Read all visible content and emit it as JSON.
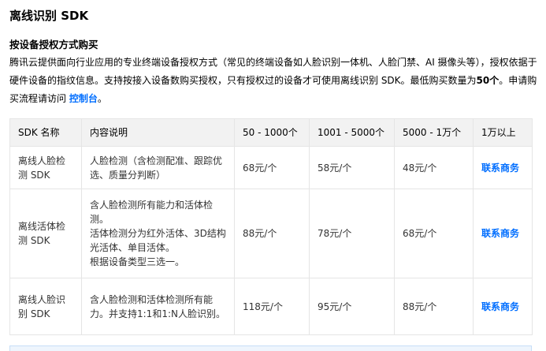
{
  "section_title": "离线识别 SDK",
  "sub_title": "按设备授权方式购买",
  "intro": {
    "text_before": "腾讯云提供面向行业应用的专业终端设备授权方式（常见的终端设备如人脸识别一体机、人脸门禁、AI 摄像头等），授权依据于硬件设备的指纹信息。支持按接入设备数购买授权，只有授权过的设备才可使用离线识别 SDK。最低购买数量为",
    "min_count": "50个",
    "text_middle": "。申请购买流程请访问 ",
    "link": "控制台",
    "text_after": "。"
  },
  "table": {
    "headers": [
      "SDK 名称",
      "内容说明",
      "50 - 1000个",
      "1001 - 5000个",
      "5000 - 1万个",
      "1万以上"
    ],
    "rows": [
      {
        "name": "离线人脸检测 SDK",
        "desc": [
          "人脸检测（含检测配准、跟踪优选、质量分判断）"
        ],
        "p1": "68元/个",
        "p2": "58元/个",
        "p3": "48元/个",
        "contact": "联系商务"
      },
      {
        "name": "离线活体检测 SDK",
        "desc": [
          "含人脸检测所有能力和活体检测。",
          "活体检测分为红外活体、3D结构光活体、单目活体。",
          "根据设备类型三选一。"
        ],
        "p1": "88元/个",
        "p2": "78元/个",
        "p3": "68元/个",
        "contact": "联系商务"
      },
      {
        "name": "离线人脸识别 SDK",
        "desc": [
          "含人脸检测和活体检测所有能力。并支持1:1和1:N人脸识别。"
        ],
        "p1": "118元/个",
        "p2": "95元/个",
        "p3": "88元/个",
        "contact": "联系商务"
      }
    ]
  }
}
